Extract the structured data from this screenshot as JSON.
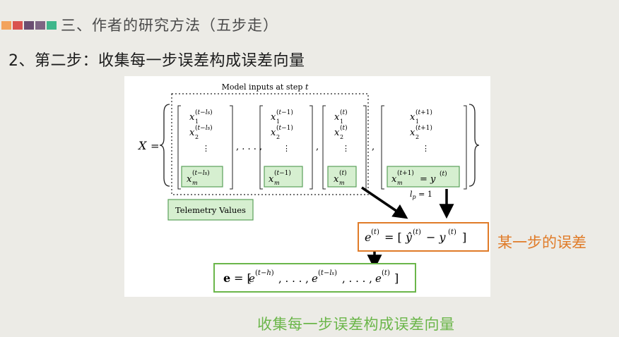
{
  "header": {
    "title": "三、作者的研究方法（五步走）",
    "accent_colors": [
      "#f3a35c",
      "#d9534f",
      "#6b4e71",
      "#3fb68b"
    ]
  },
  "step_title": "2、第二步：收集每一步误差构成误差向量",
  "figure": {
    "model_inputs_label": "Model inputs at step t",
    "telemetry_label": "Telemetry Values",
    "lp_label": "l_p = 1",
    "error_label": "某一步的误差",
    "collect_label": "收集每一步误差构成误差向量"
  },
  "colors": {
    "orange": "#e07b28",
    "green": "#6bb64a",
    "box_green": "#d6efd0"
  }
}
